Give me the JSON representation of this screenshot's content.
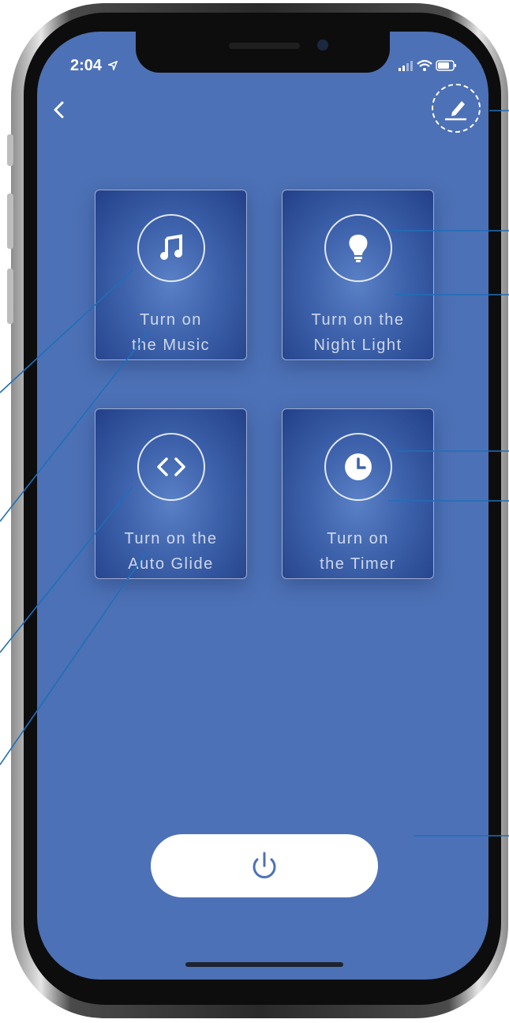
{
  "status_bar": {
    "time": "2:04"
  },
  "icons": {
    "back": "chevron-left-icon",
    "edit": "pencil-edit-icon",
    "music": "music-note-icon",
    "night_light": "light-bulb-icon",
    "auto_glide": "code-brackets-icon",
    "timer": "clock-icon",
    "power": "power-icon"
  },
  "tiles": [
    {
      "line1": "Turn on",
      "line2": "the Music"
    },
    {
      "line1": "Turn on the",
      "line2": "Night Light"
    },
    {
      "line1": "Turn on the",
      "line2": "Auto Glide"
    },
    {
      "line1": "Turn on",
      "line2": "the Timer"
    }
  ],
  "colors": {
    "screen_background": "#4d71b6",
    "callout_line": "#1f6fb8",
    "power_button": "#ffffff"
  }
}
